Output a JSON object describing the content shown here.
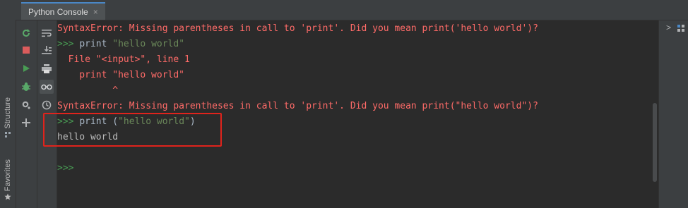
{
  "window": {
    "tab_label": "Python Console",
    "tab_close": "×"
  },
  "left_strip": {
    "structure_label": "Structure",
    "favorites_label": "Favorites"
  },
  "toolbar": {
    "buttons": [
      "rerun-icon",
      "stop-icon",
      "run-icon",
      "debug-icon",
      "settings-icon",
      "add-icon"
    ],
    "secondary_buttons": [
      "soft-wrap-icon",
      "scroll-to-end-icon",
      "print-icon",
      "show-variables-icon",
      "history-icon"
    ]
  },
  "console": {
    "lines": [
      {
        "type": "error",
        "text": "SyntaxError: Missing parentheses in call to 'print'. Did you mean print('hello world')?"
      },
      {
        "type": "input",
        "prompt": ">>> ",
        "code": "print ",
        "string": "\"hello world\""
      },
      {
        "type": "error",
        "text": "  File \"<input>\", line 1"
      },
      {
        "type": "error",
        "text": "    print \"hello world\""
      },
      {
        "type": "error",
        "text": "          ^"
      },
      {
        "type": "error",
        "text": "SyntaxError: Missing parentheses in call to 'print'. Did you mean print(\"hello world\")?"
      },
      {
        "type": "input",
        "prompt": ">>> ",
        "code": "print (",
        "string": "\"hello world\"",
        "code_after": ")"
      },
      {
        "type": "output",
        "text": "hello world"
      },
      {
        "type": "blank",
        "text": ""
      },
      {
        "type": "prompt",
        "prompt": ">>>"
      }
    ]
  },
  "right_panel": {
    "expand_glyph": ">"
  },
  "colors": {
    "error": "#ff6b68",
    "prompt": "#499c54",
    "string": "#6a8759",
    "highlight": "#e0231c"
  }
}
